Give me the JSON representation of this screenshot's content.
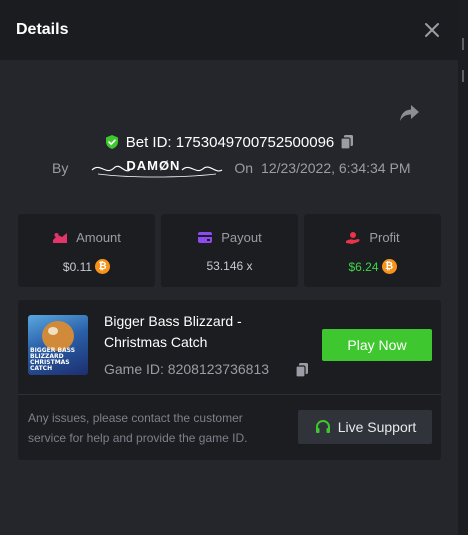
{
  "header": {
    "title": "Details"
  },
  "bet": {
    "id_text": "Bet ID: 1753049700752500096",
    "by_label": "By",
    "username": "DAMØN",
    "on_label": "On",
    "date": "12/23/2022, 6:34:34 PM"
  },
  "stats": [
    {
      "label": "Amount",
      "value": "$0.11",
      "icon": "amount-icon",
      "currency_icon": "bitcoin-icon"
    },
    {
      "label": "Payout",
      "value": "53.146 x",
      "icon": "card-icon"
    },
    {
      "label": "Profit",
      "value": "$6.24",
      "icon": "profit-hand-icon",
      "currency_icon": "bitcoin-icon"
    }
  ],
  "game": {
    "name": "Bigger Bass Blizzard - Christmas Catch",
    "thumb_caption": "BIGGER BASS BLIZZARD CHRISTMAS CATCH",
    "id_text": "Game ID: 8208123736813",
    "play_label": "Play Now"
  },
  "support": {
    "message": "Any issues, please contact the customer service for help and provide the game ID.",
    "button_label": "Live Support"
  },
  "colors": {
    "accent_green": "#3fc72f",
    "profit_green": "#3fd34a",
    "amount_pink": "#e2366b",
    "payout_purple": "#8c4bf0",
    "profit_red": "#e8344a",
    "bitcoin_orange": "#f7931a"
  }
}
